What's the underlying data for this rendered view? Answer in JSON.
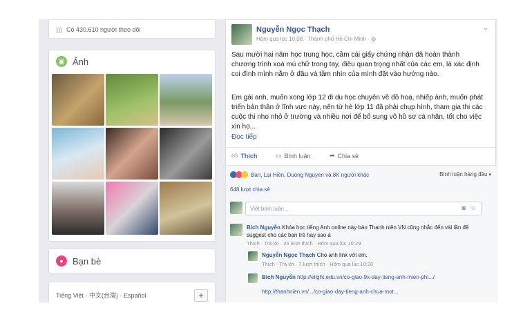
{
  "left": {
    "followers_text": "Có 430.610 người theo dõi",
    "photos_title": "Ảnh",
    "friends_title": "Bạn bè",
    "languages": "Tiếng Việt · 中文(台灣) · Español"
  },
  "post": {
    "author": "Nguyễn Ngọc Thạch",
    "meta": "Hôm qua lúc 10:08 · Thành phố Hồ Chí Minh · ",
    "paragraph1": "Sau mười hai năm học trung học, cầm cái giấy chứng nhận đã hoàn thành chương trình xoá mù chữ trong tay, điều quan trọng nhất của các em, là xác định coi đình mình nằm ở đâu và tầm nhìn của mình đặt vào hướng nào.",
    "paragraph2": "Em gái anh, muốn xong lớp 12 đi du học chuyên về đồ hoạ, nhiếp ảnh, muốn phát triển bản thân ở lĩnh vực này, nên từ hè lớp 11 đã phải chụp hình, tham gia thi các cuộc thi nho nhỏ ở trường và nhiều nơi để bổ sung vô hồ sơ cá nhân, tốt cho việc xin họ...",
    "read_more": "Đọc tiếp",
    "actions": {
      "like": "Thích",
      "comment": "Bình luận",
      "share": "Chia sẻ"
    },
    "reactions_text": "Ban, Lại Hiền, Duong Nguyen và 8K người khác",
    "sort_label": "Bình luận hàng đầu",
    "shares": "648 lượt chia sẻ",
    "comment_placeholder": "Viết bình luận..."
  },
  "comments": [
    {
      "author": "Bích Nguyễn",
      "text": "Khóa học tiếng Anh online này báo Thanh niên VN cũng nhắc đến vài lần để suggest cho các bạn trẻ hay sao á",
      "meta": "Thích · Trả lời · 26 lượt thích · Hôm qua lúc 10:29"
    },
    {
      "author": "Nguyễn Ngọc Thạch",
      "text": "Cho anh link với em.",
      "meta": "Thích · Trả lời · 7 lượt thích · Hôm qua lúc 10:30"
    },
    {
      "author": "Bích Nguyễn",
      "text": "http://elight.edu.vn/co-giao-9x-day-tieng-anh-mien-phi.../",
      "text2": "http://thanhnien.vn/.../co-giao-day-tieng-anh-chua-mot..."
    }
  ],
  "colors": {
    "brand_blue": "#4267b2",
    "link": "#365899",
    "photos_green": "#84c665",
    "friends_pink": "#e4457c"
  }
}
